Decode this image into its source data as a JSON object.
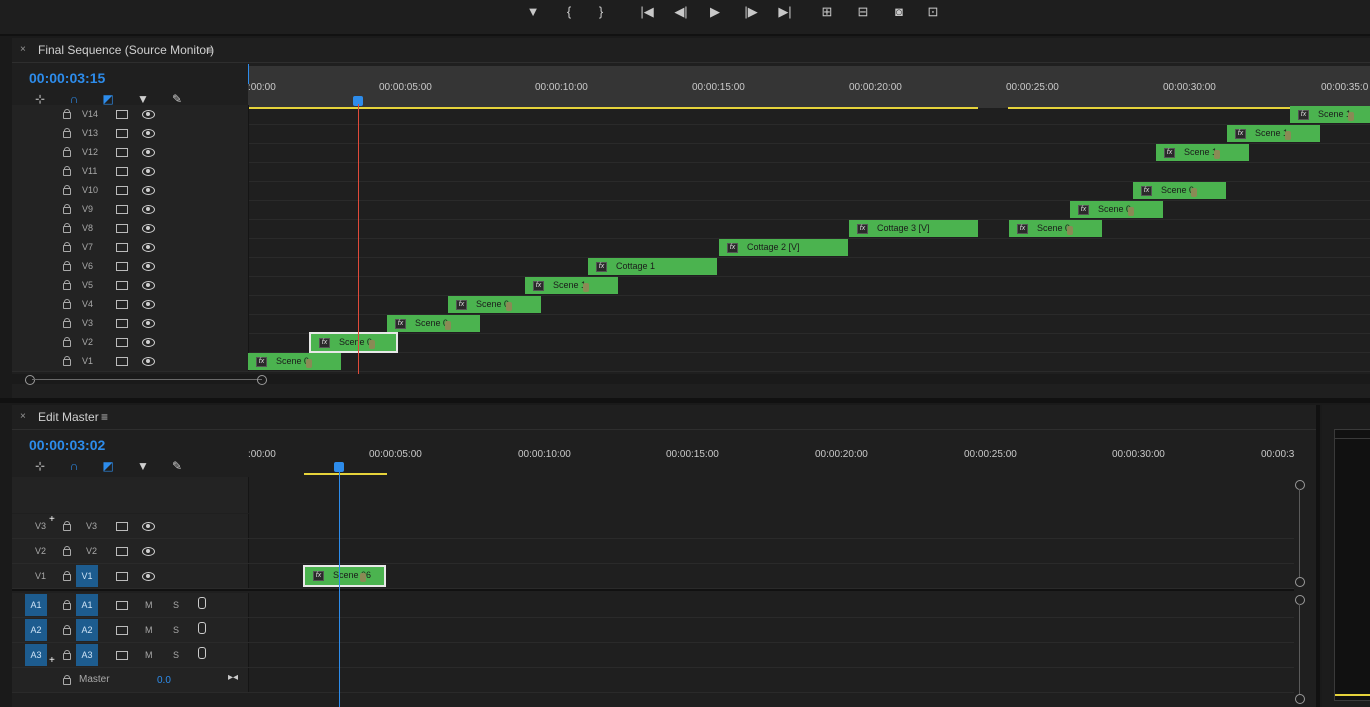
{
  "transport": {
    "buttons": [
      "add-marker",
      "mark-in",
      "mark-out",
      "go-to-in",
      "step-back",
      "play",
      "step-forward",
      "go-to-out",
      "insert",
      "overwrite",
      "export-frame",
      "button-editor"
    ]
  },
  "source_panel": {
    "title": "Final Sequence (Source Monitor)",
    "close": "×",
    "menu": "≡",
    "timecode": "00:00:03:15",
    "ruler_labels": [
      ":00:00",
      "00:00:05:00",
      "00:00:10:00",
      "00:00:15:00",
      "00:00:20:00",
      "00:00:25:00",
      "00:00:30:00",
      "00:00:35:0"
    ],
    "tracks": [
      "V14",
      "V13",
      "V12",
      "V11",
      "V10",
      "V9",
      "V8",
      "V7",
      "V6",
      "V5",
      "V4",
      "V3",
      "V2",
      "V1"
    ],
    "clips": [
      {
        "track": "V14",
        "label": "Scene 1"
      },
      {
        "track": "V13",
        "label": "Scene 1"
      },
      {
        "track": "V12",
        "label": "Scene 1"
      },
      {
        "track": "V10",
        "label": "Scene 0"
      },
      {
        "track": "V9",
        "label": "Scene 0"
      },
      {
        "track": "V8",
        "label": "Cottage 3 [V]"
      },
      {
        "track": "V8",
        "label": "Scene 0"
      },
      {
        "track": "V7",
        "label": "Cottage 2 [V]"
      },
      {
        "track": "V6",
        "label": "Cottage 1"
      },
      {
        "track": "V5",
        "label": "Scene 1"
      },
      {
        "track": "V4",
        "label": "Scene 0"
      },
      {
        "track": "V3",
        "label": "Scene 0"
      },
      {
        "track": "V2",
        "label": "Scene 0"
      },
      {
        "track": "V1",
        "label": "Scene 0"
      }
    ]
  },
  "edit_panel": {
    "title": "Edit Master",
    "close": "×",
    "menu": "≡",
    "timecode": "00:00:03:02",
    "ruler_labels": [
      ":00:00",
      "00:00:05:00",
      "00:00:10:00",
      "00:00:15:00",
      "00:00:20:00",
      "00:00:25:00",
      "00:00:30:00",
      "00:00:3"
    ],
    "video_tracks": [
      {
        "src": "V3",
        "dst": "V3"
      },
      {
        "src": "V2",
        "dst": "V2"
      },
      {
        "src": "V1",
        "dst": "V1"
      }
    ],
    "audio_tracks": [
      {
        "src": "A1",
        "dst": "A1",
        "m": "M",
        "s": "S"
      },
      {
        "src": "A2",
        "dst": "A2",
        "m": "M",
        "s": "S"
      },
      {
        "src": "A3",
        "dst": "A3",
        "m": "M",
        "s": "S"
      }
    ],
    "master_label": "Master",
    "master_value": "0.0",
    "clip_label": "Scene 06"
  },
  "colors": {
    "accent": "#2d8ceb",
    "clip": "#4bb34f",
    "playhead_source": "#e04a3a",
    "playhead_edit": "#2d8ceb",
    "inout": "#e6d33b"
  }
}
